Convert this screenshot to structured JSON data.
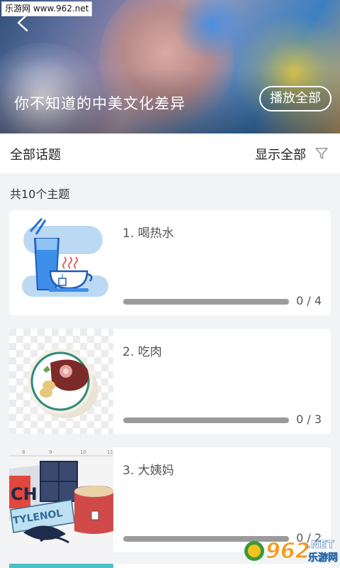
{
  "watermark": "乐游网 www.962.net",
  "hero": {
    "title": "你不知道的中美文化差异",
    "play_all_label": "播放全部"
  },
  "topic_bar": {
    "left_label": "全部话题",
    "right_label": "显示全部"
  },
  "count_text": "共10个主题",
  "topics": [
    {
      "title": "1. 喝热水",
      "progress_text": "0 / 4",
      "progress": 0
    },
    {
      "title": "2. 吃肉",
      "progress_text": "0 / 3",
      "progress": 0
    },
    {
      "title": "3. 大姨妈",
      "progress_text": "0 / 2",
      "progress": 0
    }
  ],
  "thumb_text": {
    "tylenol": "TYLENOL",
    "ch": "CH",
    "ruler": [
      "8",
      "9",
      "10",
      "11"
    ]
  },
  "badge": {
    "num": "962",
    "net": ".NET",
    "cn": "乐游网"
  },
  "colors": {
    "accent": "#3d8ee8",
    "text": "#222222",
    "progress_track": "#9b9b9b",
    "bg": "#f2f3f5"
  }
}
